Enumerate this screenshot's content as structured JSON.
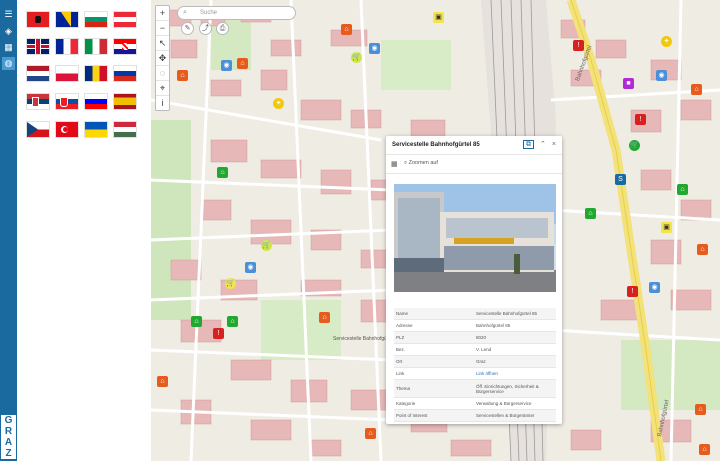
{
  "app": {
    "logo_text": "GRAZ",
    "strip_buttons": [
      {
        "name": "menu-icon",
        "glyph": "☰"
      },
      {
        "name": "layers-icon",
        "glyph": "◈"
      },
      {
        "name": "grid-icon",
        "glyph": "▦"
      },
      {
        "name": "globe-icon",
        "glyph": "◍"
      }
    ]
  },
  "languages": [
    {
      "id": "al",
      "label": "Albanian"
    },
    {
      "id": "ba",
      "label": "Bosnian"
    },
    {
      "id": "bg",
      "label": "Bulgarian"
    },
    {
      "id": "at",
      "label": "German"
    },
    {
      "id": "gb",
      "label": "English"
    },
    {
      "id": "fr",
      "label": "French"
    },
    {
      "id": "it",
      "label": "Italian"
    },
    {
      "id": "hr",
      "label": "Croatian"
    },
    {
      "id": "nl",
      "label": "Dutch"
    },
    {
      "id": "pl",
      "label": "Polish"
    },
    {
      "id": "ro",
      "label": "Romanian"
    },
    {
      "id": "ru",
      "label": "Russian"
    },
    {
      "id": "rs",
      "label": "Serbian"
    },
    {
      "id": "sk",
      "label": "Slovak"
    },
    {
      "id": "si",
      "label": "Slovenian"
    },
    {
      "id": "es",
      "label": "Spanish"
    },
    {
      "id": "cz",
      "label": "Czech"
    },
    {
      "id": "tr",
      "label": "Turkish"
    },
    {
      "id": "ua",
      "label": "Ukrainian"
    },
    {
      "id": "hu",
      "label": "Hungarian"
    }
  ],
  "search": {
    "placeholder": "Suche"
  },
  "map_toolbar": [
    {
      "name": "zoom-in-button",
      "glyph": "+"
    },
    {
      "name": "zoom-out-button",
      "glyph": "−"
    },
    {
      "name": "select-tool-button",
      "glyph": "↖"
    },
    {
      "name": "pan-tool-button",
      "glyph": "✥"
    },
    {
      "name": "measure-tool-button",
      "glyph": "◌"
    },
    {
      "name": "locate-button",
      "glyph": "⌖"
    },
    {
      "name": "info-button",
      "glyph": "i"
    }
  ],
  "map_labels": {
    "street_1": "Bahnhofgürtel",
    "street_2": "Bahnhofgürtel",
    "building_label": "Servicestelle Bahnhofgürtel"
  },
  "popup": {
    "title": "Servicestelle Bahnhofgürtel 85",
    "zoom_link": "Zoomen auf",
    "rows": [
      {
        "key": "Name",
        "value": "Servicestelle Bahnhofgürtel 85"
      },
      {
        "key": "Adresse",
        "value": "Bahnhofgürtel 85"
      },
      {
        "key": "PLZ",
        "value": "8020"
      },
      {
        "key": "Bez.",
        "value": "V. Lend"
      },
      {
        "key": "Ort",
        "value": "Graz"
      },
      {
        "key": "Link",
        "value": "Link öffnen",
        "link": true
      },
      {
        "key": "Thema",
        "value": "Öff. Einrichtungen, Sicherheit & Bürgerservice"
      },
      {
        "key": "Kategorie",
        "value": "Verwaltung & Bürgerservice"
      },
      {
        "key": "Point of Interest",
        "value": "Servicestellen & Bürgerämter"
      }
    ]
  }
}
